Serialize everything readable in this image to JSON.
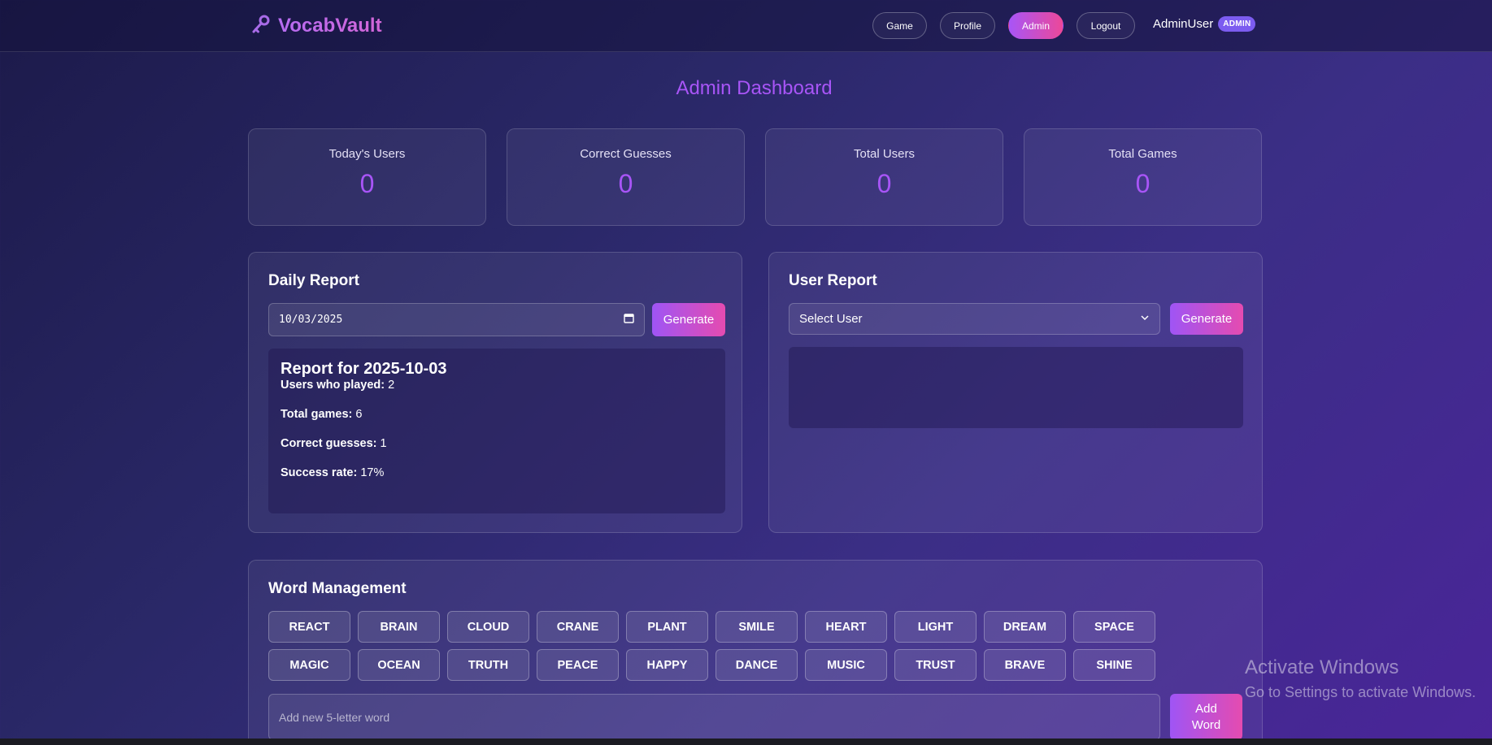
{
  "brand": {
    "name": "VocabVault",
    "icon": "key-icon"
  },
  "nav": {
    "game": "Game",
    "profile": "Profile",
    "admin": "Admin",
    "logout": "Logout"
  },
  "user": {
    "name": "AdminUser",
    "badge": "ADMIN"
  },
  "page_title": "Admin Dashboard",
  "stats": [
    {
      "label": "Today's Users",
      "value": "0"
    },
    {
      "label": "Correct Guesses",
      "value": "0"
    },
    {
      "label": "Total Users",
      "value": "0"
    },
    {
      "label": "Total Games",
      "value": "0"
    }
  ],
  "daily_report": {
    "title": "Daily Report",
    "date_value": "10/03/2025",
    "generate_label": "Generate",
    "report_title": "Report for 2025-10-03",
    "lines": [
      {
        "label": "Users who played:",
        "value": "2"
      },
      {
        "label": "Total games:",
        "value": "6"
      },
      {
        "label": "Correct guesses:",
        "value": "1"
      },
      {
        "label": "Success rate:",
        "value": "17%"
      }
    ]
  },
  "user_report": {
    "title": "User Report",
    "select_value": "Select User",
    "generate_label": "Generate"
  },
  "word_management": {
    "title": "Word Management",
    "words": [
      "REACT",
      "BRAIN",
      "CLOUD",
      "CRANE",
      "PLANT",
      "SMILE",
      "HEART",
      "LIGHT",
      "DREAM",
      "SPACE",
      "MAGIC",
      "OCEAN",
      "TRUTH",
      "PEACE",
      "HAPPY",
      "DANCE",
      "MUSIC",
      "TRUST",
      "BRAVE",
      "SHINE"
    ],
    "input_placeholder": "Add new 5-letter word",
    "add_label_line1": "Add",
    "add_label_line2": "Word"
  },
  "watermark": {
    "line1": "Activate Windows",
    "line2": "Go to Settings to activate Windows."
  },
  "colors": {
    "accent": "#a855f7",
    "gradient_end": "#ec4899",
    "badge": "#7c5cf0"
  }
}
